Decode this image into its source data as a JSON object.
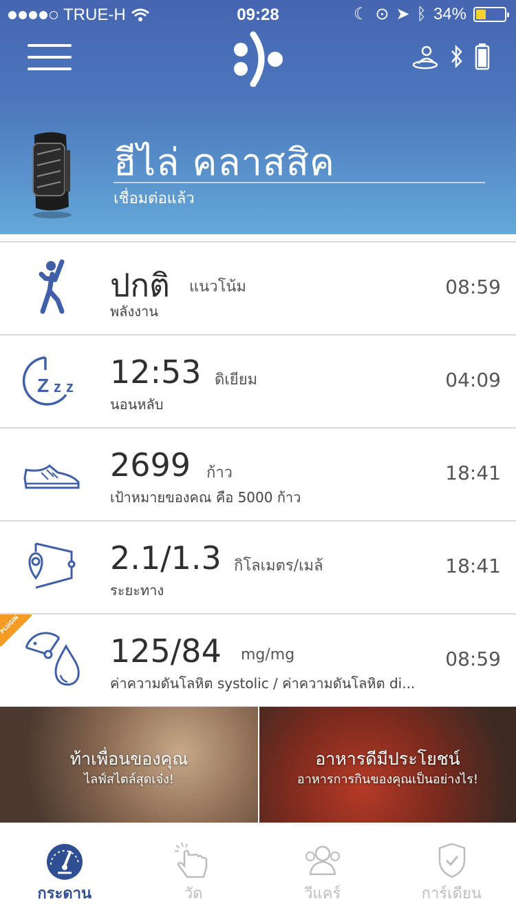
{
  "status_bar": {
    "carrier": "TRUE-H",
    "time": "09:28",
    "battery": "34%",
    "battery_level": 0.34
  },
  "device": {
    "name": "ฮีไล่ คลาสสิค",
    "status": "เชื่อมต่อแล้ว"
  },
  "rows": [
    {
      "value": "ปกติ",
      "unit": "แนวโน้ม",
      "label": "พลังงาน",
      "time": "08:59",
      "icon": "activity-icon"
    },
    {
      "value": "12:53",
      "unit": "ดิเยียม",
      "label": "นอนหลับ",
      "time": "04:09",
      "icon": "sleep-icon"
    },
    {
      "value": "2699",
      "unit": "ก้าว",
      "label": "เป้าหมายของคณ คือ 5000 ก้าว",
      "time": "18:41",
      "icon": "shoe-icon"
    },
    {
      "value": "2.1/1.3",
      "unit": "กิโลเมตร/เมล้",
      "label": "ระยะทาง",
      "time": "18:41",
      "icon": "distance-icon"
    },
    {
      "value": "125/84",
      "unit": "mg/mg",
      "label": "ค่าความดันโลหิต systolic / ค่าความดันโลหิต di...",
      "time": "08:59",
      "icon": "blood-pressure-icon",
      "tag": "PLUGIN"
    }
  ],
  "promos": [
    {
      "title": "ท้าเพื่อนของคุณ",
      "subtitle": "ไลฟ์สไตล์สุดเจ๋ง!"
    },
    {
      "title": "อาหารดีมีประโยชน์",
      "subtitle": "อาหารการกินของคุณเป็นอย่างไร!"
    }
  ],
  "tabs": [
    {
      "label": "กระดาน",
      "icon": "dashboard-icon",
      "active": true
    },
    {
      "label": "วัด",
      "icon": "touch-icon",
      "active": false
    },
    {
      "label": "วีแคร์",
      "icon": "people-icon",
      "active": false
    },
    {
      "label": "การ์เดียน",
      "icon": "shield-icon",
      "active": false
    }
  ],
  "colors": {
    "header_top": "#4565b0",
    "header_bottom": "#64a8d8",
    "icon_blue": "#3f5fa8",
    "plugin_orange": "#f59a23"
  }
}
